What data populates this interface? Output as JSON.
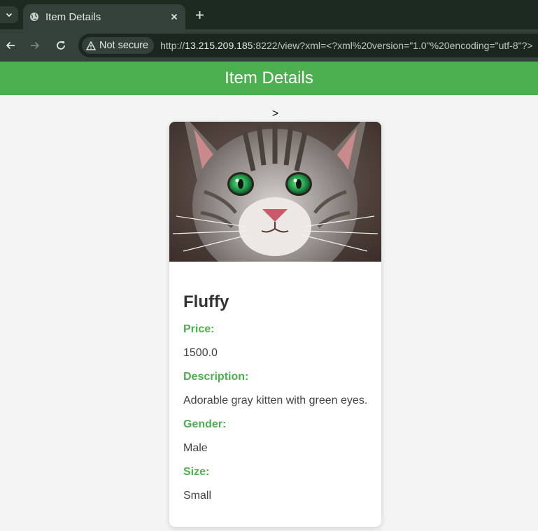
{
  "browser": {
    "tab_title": "Item Details",
    "security_label": "Not secure",
    "url_prefix": "http://",
    "url_host": "13.215.209.185",
    "url_rest": ":8222/view?xml=<?xml%20version=\"1.0\"%20encoding=\"utf-8\"?>"
  },
  "page": {
    "title": "Item Details",
    "stray_text": ">"
  },
  "item": {
    "image_alt": "Gray tabby kitten with green eyes",
    "name": "Fluffy",
    "price_label": "Price:",
    "price": "1500.0",
    "description_label": "Description:",
    "description": "Adorable gray kitten with green eyes.",
    "gender_label": "Gender:",
    "gender": "Male",
    "size_label": "Size:",
    "size": "Small"
  },
  "colors": {
    "accent": "#4caf50",
    "browser_frame": "#1c2a1f",
    "browser_toolbar": "#33413a"
  }
}
